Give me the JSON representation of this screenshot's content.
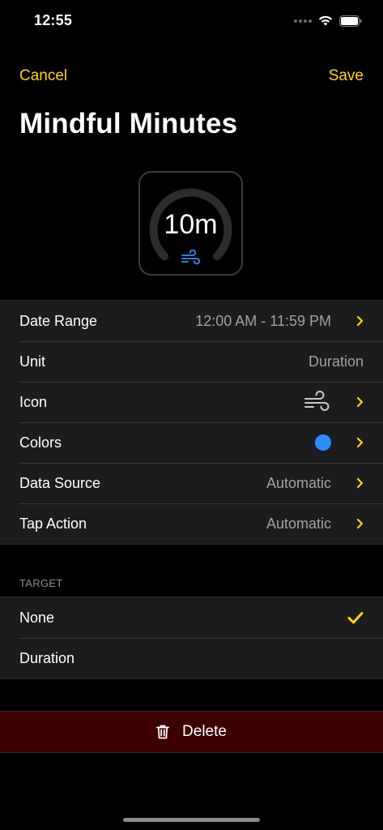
{
  "status_bar": {
    "time": "12:55"
  },
  "nav": {
    "cancel_label": "Cancel",
    "save_label": "Save",
    "title": "Mindful Minutes"
  },
  "widget": {
    "value": "10m",
    "icon": "wind-icon",
    "accent": "#2f7de1"
  },
  "settings": {
    "rows": [
      {
        "label": "Date Range",
        "value": "12:00 AM - 11:59 PM"
      },
      {
        "label": "Unit",
        "value": "Duration"
      },
      {
        "label": "Icon",
        "icon": "wind-icon"
      },
      {
        "label": "Colors",
        "color": "#2a8cff"
      },
      {
        "label": "Data Source",
        "value": "Automatic"
      },
      {
        "label": "Tap Action",
        "value": "Automatic"
      }
    ]
  },
  "target": {
    "header": "TARGET",
    "options": [
      {
        "label": "None",
        "selected": true
      },
      {
        "label": "Duration",
        "selected": false
      }
    ]
  },
  "delete": {
    "label": "Delete",
    "color": "#3d0000"
  },
  "accent_color": "#ffd60a"
}
